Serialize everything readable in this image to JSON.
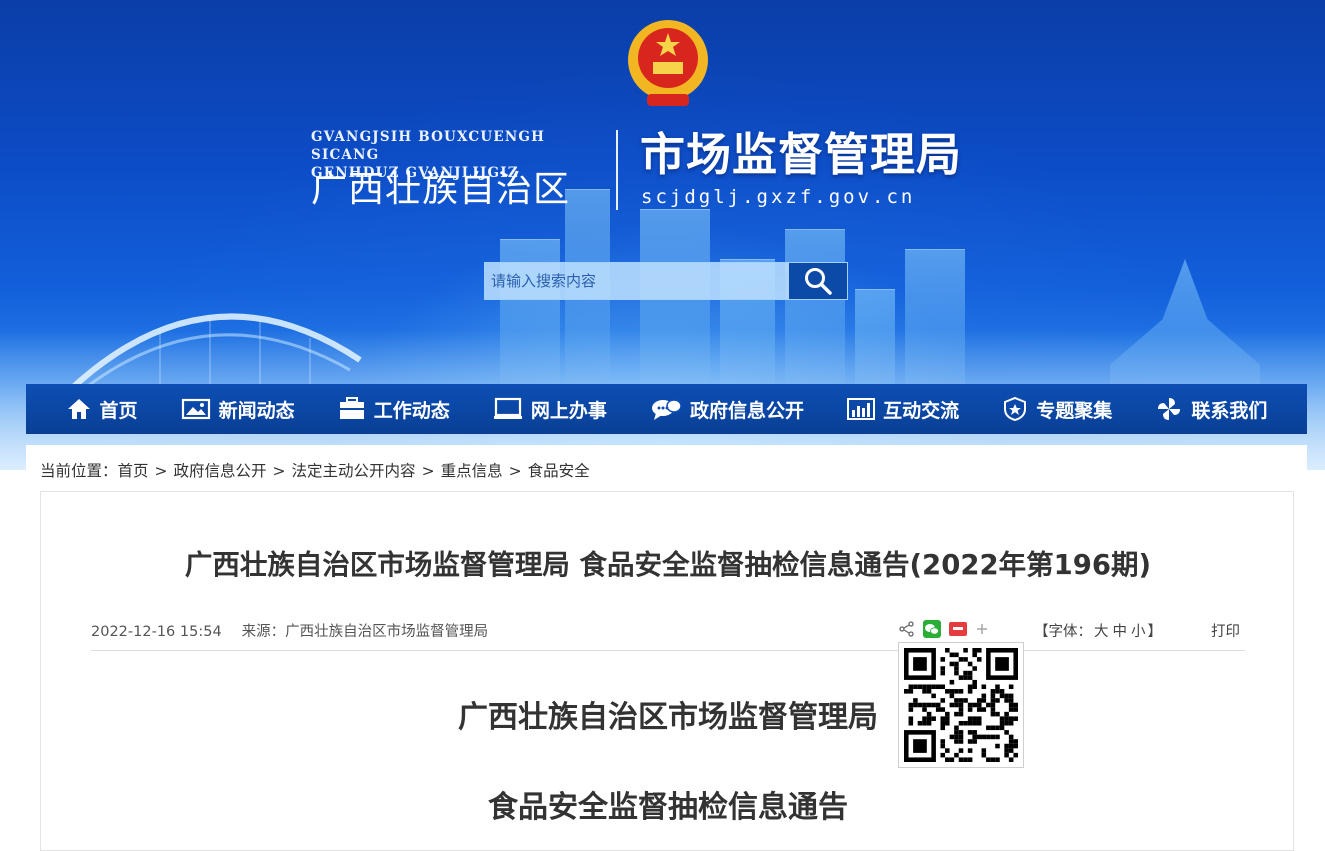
{
  "header": {
    "region_en_line1": "GVANGJSIH BOUXCUENGH SICANG",
    "region_en_line2": "GENHDUZ GVANJLIJGIZ",
    "region_cn": "广西壮族自治区",
    "agency": "市场监督管理局",
    "domain": "scjdglj.gxzf.gov.cn",
    "emblem_icon": "national-emblem-icon"
  },
  "search": {
    "placeholder": "请输入搜索内容",
    "icon": "search-icon"
  },
  "nav": {
    "items": [
      {
        "label": "首页",
        "icon": "home-icon"
      },
      {
        "label": "新闻动态",
        "icon": "image-icon"
      },
      {
        "label": "工作动态",
        "icon": "briefcase-icon"
      },
      {
        "label": "网上办事",
        "icon": "monitor-icon"
      },
      {
        "label": "政府信息公开",
        "icon": "speech-bubble-icon"
      },
      {
        "label": "互动交流",
        "icon": "bar-chart-icon"
      },
      {
        "label": "专题聚集",
        "icon": "shield-icon"
      },
      {
        "label": "联系我们",
        "icon": "pinwheel-icon"
      }
    ]
  },
  "breadcrumb": {
    "prefix": "当前位置：",
    "items": [
      "首页",
      "政府信息公开",
      "法定主动公开内容",
      "重点信息",
      "食品安全"
    ],
    "separator": ">"
  },
  "article": {
    "title": "广西壮族自治区市场监督管理局 食品安全监督抽检信息通告(2022年第196期)",
    "date": "2022-12-16 15:54",
    "source_label": "来源：",
    "source": "广西壮族自治区市场监督管理局",
    "font_label_open": "【字体：",
    "font_sizes": [
      "大",
      "中",
      "小"
    ],
    "font_label_close": "】",
    "print_label": "打印",
    "body_line1": "广西壮族自治区市场监督管理局",
    "body_line2": "食品安全监督抽检信息通告"
  },
  "colors": {
    "nav_bg": "#0c4fb4",
    "banner_top": "#0b3ea8",
    "wechat": "#2aae35",
    "weibo": "#e53d3d"
  }
}
